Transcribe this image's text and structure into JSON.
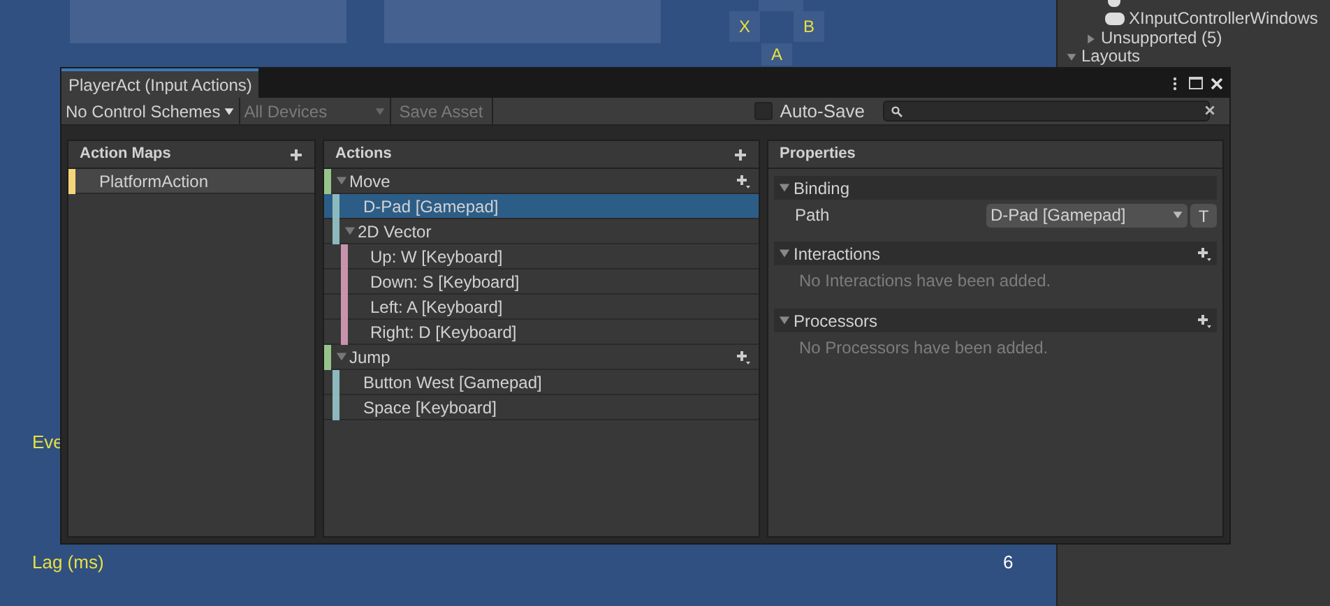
{
  "scene": {
    "gamepad_buttons": [
      "X",
      "B",
      "A"
    ],
    "stats": [
      {
        "label": "Eve"
      },
      {
        "label": "Lag (ms)",
        "value": "6"
      }
    ]
  },
  "hierarchy": {
    "items": [
      {
        "label": "XInputControllerWindows",
        "kind": "gamepad"
      },
      {
        "label": "Unsupported (5)",
        "kind": "folder",
        "expanded": false
      },
      {
        "label": "Layouts",
        "kind": "folder",
        "expanded": true
      }
    ]
  },
  "window": {
    "title": "PlayerAct (Input Actions)",
    "toolbar": {
      "control_scheme": "No Control Schemes",
      "devices": {
        "label": "All Devices",
        "disabled": true
      },
      "save": {
        "label": "Save Asset",
        "disabled": true
      },
      "auto_save": {
        "label": "Auto-Save",
        "checked": false
      }
    },
    "action_maps": {
      "title": "Action Maps",
      "items": [
        {
          "label": "PlatformAction",
          "selected": true
        }
      ]
    },
    "actions": {
      "title": "Actions",
      "items": [
        {
          "kind": "action",
          "label": "Move",
          "expanded": true,
          "selected": false,
          "children": [
            {
              "kind": "binding",
              "label": "D-Pad [Gamepad]",
              "selected": true
            },
            {
              "kind": "composite",
              "label": "2D Vector",
              "expanded": true,
              "selected": false,
              "children": [
                {
                  "kind": "part",
                  "label": "Up: W [Keyboard]",
                  "selected": false
                },
                {
                  "kind": "part",
                  "label": "Down: S [Keyboard]",
                  "selected": false
                },
                {
                  "kind": "part",
                  "label": "Left: A [Keyboard]",
                  "selected": false
                },
                {
                  "kind": "part",
                  "label": "Right: D [Keyboard]",
                  "selected": false
                }
              ]
            }
          ]
        },
        {
          "kind": "action",
          "label": "Jump",
          "expanded": true,
          "selected": false,
          "children": [
            {
              "kind": "binding",
              "label": "Button West [Gamepad]",
              "selected": false
            },
            {
              "kind": "binding",
              "label": "Space [Keyboard]",
              "selected": false
            }
          ]
        }
      ]
    },
    "properties": {
      "title": "Properties",
      "sections": [
        {
          "kind": "binding",
          "title": "Binding",
          "expanded": true,
          "path_label": "Path",
          "path_value": "D-Pad [Gamepad]",
          "t_button": "T"
        },
        {
          "kind": "list",
          "title": "Interactions",
          "expanded": true,
          "empty": "No Interactions have been added."
        },
        {
          "kind": "list",
          "title": "Processors",
          "expanded": true,
          "empty": "No Processors have been added."
        }
      ]
    }
  }
}
